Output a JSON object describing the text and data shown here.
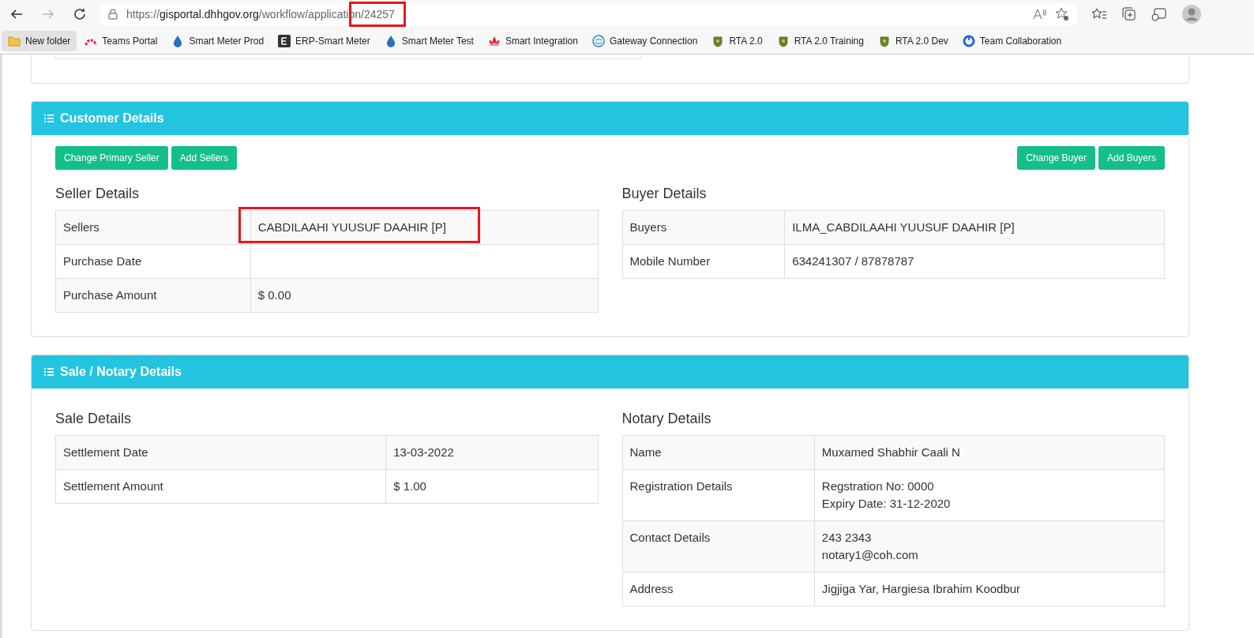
{
  "browser": {
    "url": {
      "scheme": "https://",
      "host": "gisportal.dhhgov.org",
      "path": "/workflow/application/24257",
      "highlighted": true
    },
    "bookmarks": [
      {
        "label": "New folder",
        "kind": "folder",
        "selected": true
      },
      {
        "label": "Teams Portal",
        "kind": "arc",
        "selected": false
      },
      {
        "label": "Smart Meter Prod",
        "kind": "drop",
        "selected": false
      },
      {
        "label": "ERP-Smart Meter",
        "kind": "letter",
        "selected": false
      },
      {
        "label": "Smart Meter Test",
        "kind": "drop",
        "selected": false
      },
      {
        "label": "Smart Integration",
        "kind": "lotus",
        "selected": false
      },
      {
        "label": "Gateway Connection",
        "kind": "globe",
        "selected": false
      },
      {
        "label": "RTA 2.0",
        "kind": "crest",
        "selected": false
      },
      {
        "label": "RTA 2.0 Training",
        "kind": "crest",
        "selected": false
      },
      {
        "label": "RTA 2.0 Dev",
        "kind": "crest",
        "selected": false
      },
      {
        "label": "Team Collaboration",
        "kind": "ring",
        "selected": false
      }
    ]
  },
  "sections": [
    {
      "title": "Customer Details",
      "buttons_left": [
        "Change Primary Seller",
        "Add Sellers"
      ],
      "buttons_right": [
        "Change Buyer",
        "Add Buyers"
      ],
      "panels": [
        {
          "heading": "Seller Details",
          "rows": [
            {
              "label": "Sellers",
              "value": [
                "CABDILAAHI YUUSUF DAAHIR [P]"
              ],
              "highlighted": true
            },
            {
              "label": "Purchase Date",
              "value": [],
              "highlighted": false
            },
            {
              "label": "Purchase Amount",
              "value": [
                "$ 0.00"
              ],
              "highlighted": false
            }
          ]
        },
        {
          "heading": "Buyer Details",
          "rows": [
            {
              "label": "Buyers",
              "value": [
                "ILMA_CABDILAAHI YUUSUF DAAHIR [P]"
              ],
              "highlighted": false
            },
            {
              "label": "Mobile Number",
              "value": [
                "634241307 / 87878787"
              ],
              "highlighted": false
            }
          ]
        }
      ]
    },
    {
      "title": "Sale / Notary Details",
      "panels": [
        {
          "heading": "Sale Details",
          "rows": [
            {
              "label": "Settlement Date",
              "value": [
                "13-03-2022"
              ],
              "highlighted": false
            },
            {
              "label": "Settlement Amount",
              "value": [
                "$ 1.00"
              ],
              "highlighted": false
            }
          ]
        },
        {
          "heading": "Notary Details",
          "rows": [
            {
              "label": "Name",
              "value": [
                "Muxamed Shabhir Caali N"
              ],
              "highlighted": false
            },
            {
              "label": "Registration Details",
              "value": [
                "Regstration No: 0000",
                "Expiry Date: 31-12-2020"
              ],
              "highlighted": false
            },
            {
              "label": "Contact Details",
              "value": [
                "243 2343",
                "notary1@coh.com"
              ],
              "highlighted": false
            },
            {
              "label": "Address",
              "value": [
                "Jigjiga Yar, Hargiesa Ibrahim Koodbur"
              ],
              "highlighted": false
            }
          ]
        }
      ]
    }
  ]
}
